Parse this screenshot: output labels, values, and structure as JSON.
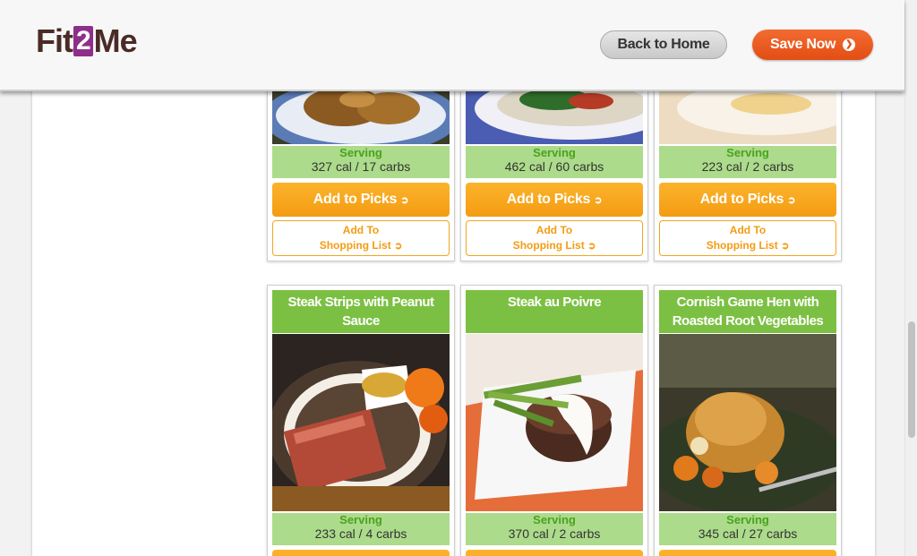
{
  "header": {
    "logo_pre": "Fit",
    "logo_mid": "2",
    "logo_post": "Me",
    "back_label": "Back to Home",
    "save_label": "Save Now"
  },
  "top_row": [
    {
      "serving_label": "Serving",
      "serving_value": "327 cal / 17 carbs",
      "picks_label": "Add to Picks",
      "list_label_1": "Add To",
      "list_label_2": "Shopping List"
    },
    {
      "serving_label": "Serving",
      "serving_value": "462 cal / 60 carbs",
      "picks_label": "Add to Picks",
      "list_label_1": "Add To",
      "list_label_2": "Shopping List"
    },
    {
      "serving_label": "Serving",
      "serving_value": "223 cal / 2 carbs",
      "picks_label": "Add to Picks",
      "list_label_1": "Add To",
      "list_label_2": "Shopping List"
    }
  ],
  "bottom_row": [
    {
      "title": "Steak Strips with Peanut Sauce",
      "serving_label": "Serving",
      "serving_value": "233 cal / 4 carbs"
    },
    {
      "title": "Steak au Poivre",
      "serving_label": "Serving",
      "serving_value": "370 cal / 2 carbs"
    },
    {
      "title": "Cornish Game Hen with Roasted Root Vegetables",
      "serving_label": "Serving",
      "serving_value": "345 cal / 27 carbs"
    }
  ],
  "colors": {
    "title_green": "#7cc043",
    "serving_green": "#acdb8b",
    "picks_orange": "#f39c12",
    "save_orange": "#e24e14",
    "logo_purple": "#8e2f8a",
    "logo_brown": "#4a2b25"
  }
}
